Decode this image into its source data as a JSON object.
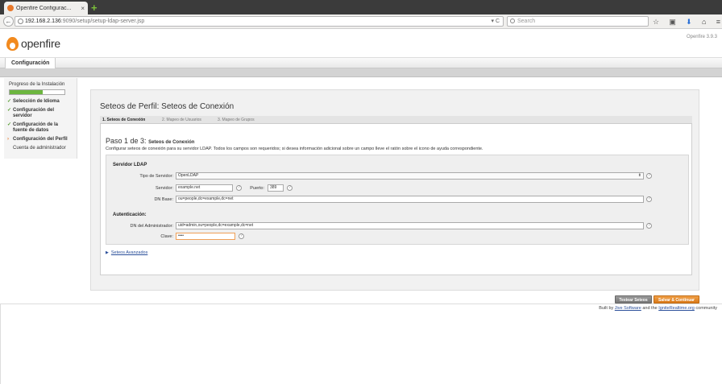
{
  "browser": {
    "tab_title": "Openfire Configurac...",
    "tab_close": "×",
    "new_tab": "+",
    "back": "←",
    "url_host": "192.168.2.136",
    "url_rest": ":9090/setup/setup-ldap-server.jsp",
    "url_right": "▾ C",
    "search_placeholder": "Search",
    "icons": [
      "star-icon",
      "clipboard-icon",
      "download-icon",
      "home-icon",
      "menu-icon"
    ]
  },
  "header": {
    "logo_text": "openfire",
    "version": "Openfire 3.9.3"
  },
  "tabbar": {
    "config_tab": "Configuración"
  },
  "sidebar": {
    "progress_label": "Progreso de la Instalación",
    "progress_fraction": 0.6,
    "steps": [
      {
        "label": "Selección de Idioma",
        "state": "done"
      },
      {
        "label": "Configuración del servidor",
        "state": "done"
      },
      {
        "label": "Configuración de la fuente de datos",
        "state": "done"
      },
      {
        "label": "Configuración del Perfil",
        "state": "current"
      },
      {
        "label": "Cuenta de administrador",
        "state": "pending"
      }
    ]
  },
  "main": {
    "title": "Seteos de Perfil: Seteos de Conexión",
    "wizard_tabs": [
      "1. Seteos de Conexión",
      "2. Mapeo de Usuarios",
      "3. Mapeo de Grupos"
    ],
    "step_heading": "Paso 1 de 3:",
    "step_sub": "Seteos de Conexión",
    "description": "Configurar seteos de conexión para su servidor LDAP. Todos los campos son requeridos; si desea información adicional sobre un campo lleve el ratón sobre el icono de ayuda correspondiente.",
    "server_section": "Servidor LDAP",
    "server_type_label": "Tipo de Servidor:",
    "server_type_value": "OpenLDAP",
    "server_label": "Servidor:",
    "server_value": "example.net",
    "port_label": "Puerto:",
    "port_value": "389",
    "dn_base_label": "DN Base:",
    "dn_base_value": "ou=people,dc=example,dc=net",
    "auth_section": "Autenticación:",
    "admin_dn_label": "DN del Administrador:",
    "admin_dn_value": "uid=admin,ou=people,dc=example,dc=net",
    "password_label": "Clave:",
    "password_value": "••••",
    "help": "?",
    "advanced": "Seteos Avanzados",
    "test_button": "Testear Seteos",
    "save_button": "Salvar & Continuar"
  },
  "footer": {
    "prefix": "Built by",
    "link1": "Jive Software",
    "middle": "and the",
    "link2": "IgniteRealtime.org",
    "suffix": "community"
  }
}
